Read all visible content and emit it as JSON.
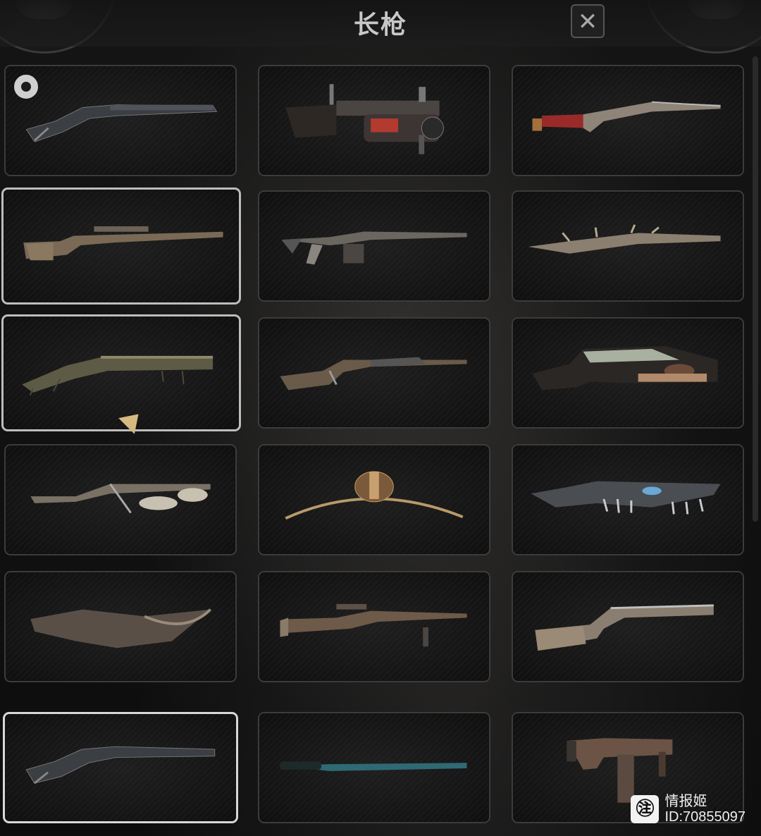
{
  "header": {
    "title": "长枪",
    "close_label": "✕"
  },
  "weapons": [
    {
      "slot": 1,
      "state": "equipped"
    },
    {
      "slot": 2,
      "state": "normal"
    },
    {
      "slot": 3,
      "state": "normal"
    },
    {
      "slot": 4,
      "state": "highlighted"
    },
    {
      "slot": 5,
      "state": "normal"
    },
    {
      "slot": 6,
      "state": "normal"
    },
    {
      "slot": 7,
      "state": "highlighted"
    },
    {
      "slot": 8,
      "state": "normal"
    },
    {
      "slot": 9,
      "state": "normal"
    },
    {
      "slot": 10,
      "state": "normal"
    },
    {
      "slot": 11,
      "state": "normal"
    },
    {
      "slot": 12,
      "state": "normal"
    },
    {
      "slot": 13,
      "state": "normal"
    },
    {
      "slot": 14,
      "state": "normal"
    },
    {
      "slot": 15,
      "state": "normal"
    },
    {
      "slot": 16,
      "state": "selected"
    },
    {
      "slot": 17,
      "state": "normal"
    },
    {
      "slot": 18,
      "state": "normal"
    }
  ],
  "watermark": {
    "logo": "㊟",
    "name": "情报姬",
    "id": "ID:70855097"
  },
  "colors": {
    "card_border": "#3c3c3c",
    "selected_border": "#d7d7d7",
    "cursor": "#d6b980"
  }
}
